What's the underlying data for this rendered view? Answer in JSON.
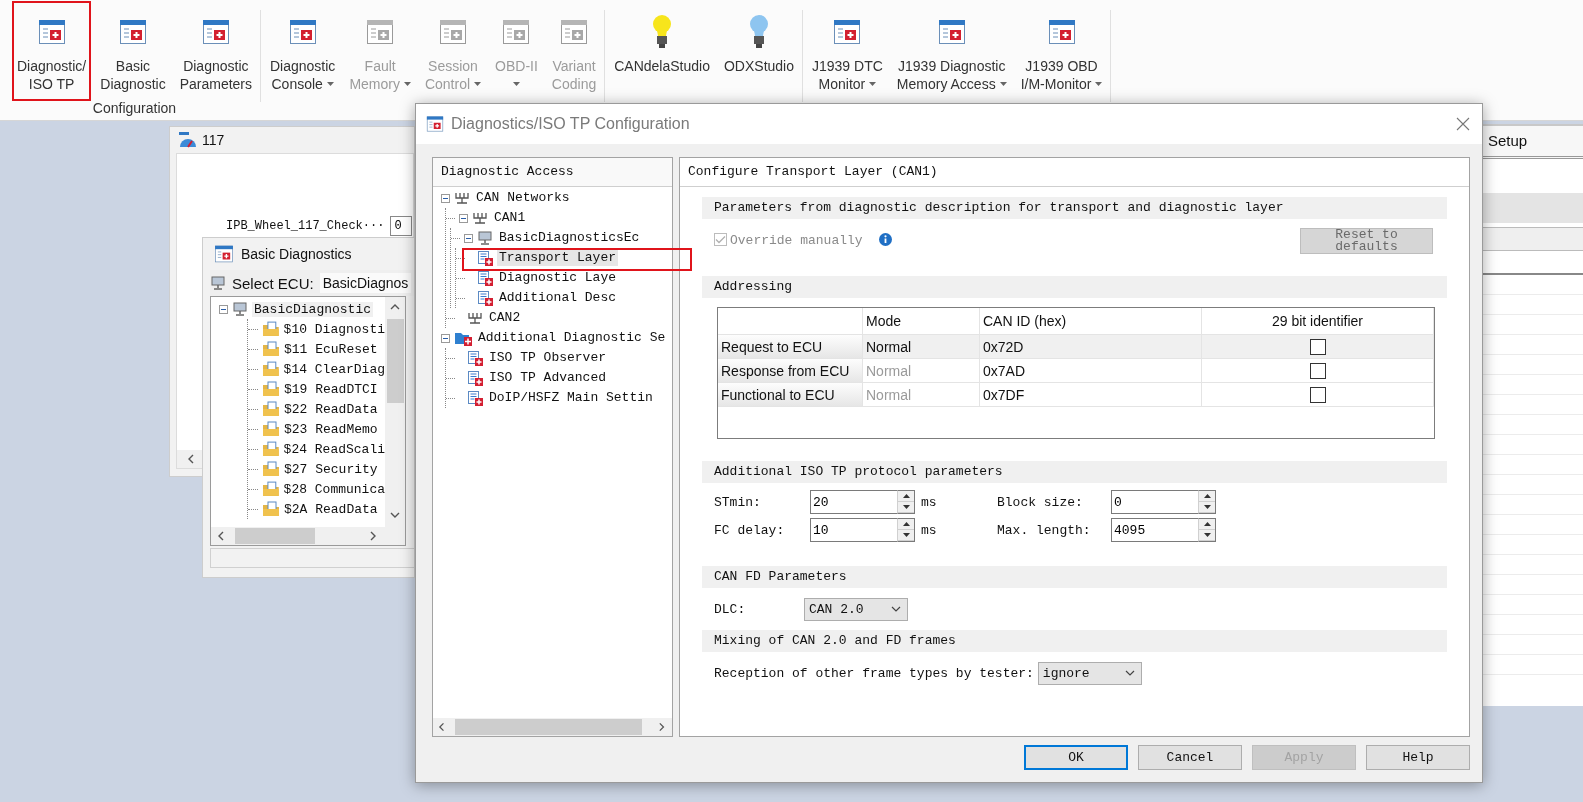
{
  "ribbon": {
    "groups": [
      {
        "label": "Configuration",
        "buttons": [
          {
            "kind": "window",
            "lines": [
              "Diagnostic/",
              "ISO TP"
            ],
            "dropdown": false,
            "disabled": false,
            "highlighted": true
          },
          {
            "kind": "window",
            "lines": [
              "Basic",
              "Diagnostic"
            ],
            "dropdown": false,
            "disabled": false,
            "highlighted": false
          },
          {
            "kind": "window",
            "lines": [
              "Diagnostic",
              "Parameters"
            ],
            "dropdown": false,
            "disabled": false,
            "highlighted": false
          }
        ]
      },
      {
        "buttons": [
          {
            "kind": "window",
            "lines": [
              "Diagnostic",
              "Console"
            ],
            "dropdown": true,
            "disabled": false,
            "highlighted": false
          },
          {
            "kind": "window",
            "lines": [
              "Fault",
              "Memory"
            ],
            "dropdown": true,
            "disabled": true,
            "highlighted": false
          },
          {
            "kind": "window",
            "lines": [
              "Session",
              "Control"
            ],
            "dropdown": true,
            "disabled": true,
            "highlighted": false
          },
          {
            "kind": "window",
            "lines": [
              "OBD-II"
            ],
            "dropdown": true,
            "disabled": true,
            "highlighted": false
          },
          {
            "kind": "window",
            "lines": [
              "Variant",
              "Coding"
            ],
            "dropdown": false,
            "disabled": true,
            "highlighted": false
          }
        ]
      },
      {
        "buttons": [
          {
            "kind": "bulb",
            "color": "#f7e51c",
            "lines": [
              "CANdelaStudio"
            ],
            "dropdown": false,
            "disabled": false,
            "highlighted": false
          },
          {
            "kind": "bulb",
            "color": "#8ec5f0",
            "lines": [
              "ODXStudio"
            ],
            "dropdown": false,
            "disabled": false,
            "highlighted": false
          }
        ]
      },
      {
        "buttons": [
          {
            "kind": "window",
            "lines": [
              "J1939 DTC",
              "Monitor"
            ],
            "dropdown": true,
            "disabled": false,
            "highlighted": false
          },
          {
            "kind": "window",
            "lines": [
              "J1939 Diagnostic",
              "Memory Access"
            ],
            "dropdown": true,
            "disabled": false,
            "highlighted": false
          },
          {
            "kind": "window",
            "lines": [
              "J1939 OBD",
              "I/M-Monitor"
            ],
            "dropdown": true,
            "disabled": false,
            "highlighted": false
          }
        ]
      }
    ]
  },
  "monitor_window": {
    "title": "117",
    "field": {
      "label": "IPB_Wheel_117_Check···",
      "value": "0"
    }
  },
  "basic_diagnostics": {
    "title": "Basic Diagnostics",
    "ecu_label": "Select ECU:",
    "ecu_value": "BasicDiagnos",
    "tree": {
      "label": "BasicDiagnostic",
      "expanded": true,
      "children": [
        {
          "label": "$10 Diagnosti"
        },
        {
          "label": "$11 EcuReset"
        },
        {
          "label": "$14 ClearDiag"
        },
        {
          "label": "$19 ReadDTCI"
        },
        {
          "label": "$22 ReadData"
        },
        {
          "label": "$23 ReadMemo"
        },
        {
          "label": "$24 ReadScali"
        },
        {
          "label": "$27 Security"
        },
        {
          "label": "$28 Communica"
        },
        {
          "label": "$2A ReadData"
        }
      ]
    }
  },
  "setup_window": {
    "title": "Setup"
  },
  "dialog": {
    "title": "Diagnostics/ISO TP Configuration",
    "tree": {
      "title": "Diagnostic Access",
      "nodes": [
        {
          "label": "CAN Networks",
          "kind": "network",
          "expanded": true,
          "selected": false,
          "highlighted": false,
          "children": [
            {
              "label": "CAN1",
              "kind": "network",
              "expanded": true,
              "selected": false,
              "highlighted": false,
              "children": [
                {
                  "label": "BasicDiagnosticsEc",
                  "kind": "ecu",
                  "expanded": true,
                  "selected": false,
                  "highlighted": false,
                  "children": [
                    {
                      "label": "Transport Layer",
                      "kind": "page",
                      "selected": true,
                      "highlighted": true
                    },
                    {
                      "label": "Diagnostic Laye",
                      "kind": "page",
                      "selected": false,
                      "highlighted": false
                    },
                    {
                      "label": "Additional Desc",
                      "kind": "page",
                      "selected": false,
                      "highlighted": false
                    }
                  ]
                }
              ]
            },
            {
              "label": "CAN2",
              "kind": "network",
              "selected": false,
              "highlighted": false
            }
          ]
        },
        {
          "label": "Additional Diagnostic Se",
          "kind": "folder",
          "expanded": true,
          "selected": false,
          "highlighted": false,
          "children": [
            {
              "label": "ISO TP Observer",
              "kind": "page",
              "selected": false,
              "highlighted": false
            },
            {
              "label": "ISO TP Advanced",
              "kind": "page",
              "selected": false,
              "highlighted": false
            },
            {
              "label": "DoIP/HSFZ Main Settin",
              "kind": "page",
              "selected": false,
              "highlighted": false
            }
          ]
        }
      ]
    },
    "panel": {
      "title": "Configure Transport Layer (CAN1)",
      "sections": [
        {
          "kind": "override",
          "title": "Parameters from diagnostic description for transport and diagnostic layer",
          "checkbox": {
            "label": "Override manually",
            "checked": true,
            "disabled": true
          },
          "button": {
            "label": "Reset to defaults",
            "disabled": true
          }
        },
        {
          "kind": "table",
          "title": "Addressing",
          "columns": [
            "Mode",
            "CAN ID (hex)",
            "29 bit identifier"
          ],
          "rows": [
            {
              "name": "Request to ECU",
              "mode": "Normal",
              "mode_disabled": false,
              "can_id": "0x72D",
              "extended": false,
              "selected": true
            },
            {
              "name": "Response from ECU",
              "mode": "Normal",
              "mode_disabled": true,
              "can_id": "0x7AD",
              "extended": false,
              "selected": false
            },
            {
              "name": "Functional to ECU",
              "mode": "Normal",
              "mode_disabled": true,
              "can_id": "0x7DF",
              "extended": false,
              "selected": false
            }
          ]
        },
        {
          "kind": "params",
          "title": "Additional ISO TP protocol parameters",
          "fields": [
            {
              "label": "STmin:",
              "value": "20",
              "unit": "ms"
            },
            {
              "label": "Block size:",
              "value": "0"
            },
            {
              "label": "FC delay:",
              "value": "10",
              "unit": "ms"
            },
            {
              "label": "Max. length:",
              "value": "4095"
            }
          ]
        },
        {
          "kind": "dropdown",
          "title": "CAN FD Parameters",
          "label": "DLC:",
          "value": "CAN 2.0"
        },
        {
          "kind": "dropdown",
          "title": "Mixing of CAN 2.0 and FD frames",
          "label": "Reception of other frame types by tester:",
          "value": "ignore"
        }
      ]
    },
    "buttons": [
      {
        "label": "OK",
        "default": true,
        "disabled": false
      },
      {
        "label": "Cancel",
        "default": false,
        "disabled": false
      },
      {
        "label": "Apply",
        "default": false,
        "disabled": true
      },
      {
        "label": "Help",
        "default": false,
        "disabled": false
      }
    ]
  }
}
